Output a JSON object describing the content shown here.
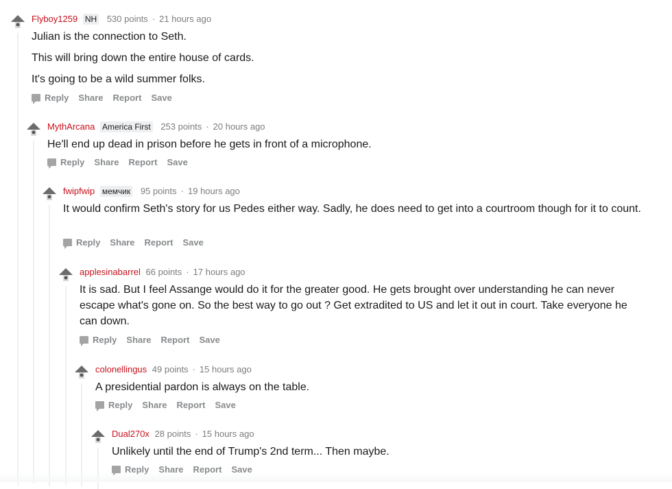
{
  "actions": {
    "reply": "Reply",
    "share": "Share",
    "report": "Report",
    "save": "Save"
  },
  "comments": [
    {
      "author": "Flyboy1259",
      "flair": "NH",
      "points": "530 points",
      "time": "21 hours ago",
      "paragraphs": [
        "Julian is the connection to Seth.",
        "This will bring down the entire house of cards.",
        "It's going to be a wild summer folks."
      ]
    },
    {
      "author": "MythArcana",
      "flair": "America First",
      "points": "253 points",
      "time": "20 hours ago",
      "paragraphs": [
        "He'll end up dead in prison before he gets in front of a microphone."
      ]
    },
    {
      "author": "fwipfwip",
      "flair": "мемчик",
      "points": "95 points",
      "time": "19 hours ago",
      "paragraphs": [
        "It would confirm Seth's story for us Pedes either way. Sadly, he does need to get into a courtroom though for it to count."
      ]
    },
    {
      "author": "applesinabarrel",
      "flair": "",
      "points": "66 points",
      "time": "17 hours ago",
      "paragraphs": [
        "It is sad. But I feel Assange would do it for the greater good. He gets brought over understanding he can never escape what's gone on. So the best way to go out ? Get extradited to US and let it out in court. Take everyone he can down."
      ]
    },
    {
      "author": "colonellingus",
      "flair": "",
      "points": "49 points",
      "time": "15 hours ago",
      "paragraphs": [
        "A presidential pardon is always on the table."
      ]
    },
    {
      "author": "Dual270x",
      "flair": "",
      "points": "28 points",
      "time": "15 hours ago",
      "paragraphs": [
        "Unlikely until the end of Trump's 2nd term... Then maybe."
      ]
    }
  ]
}
